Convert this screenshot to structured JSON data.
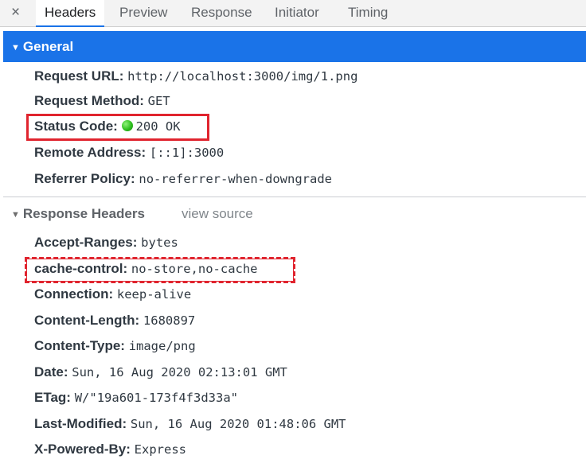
{
  "tabs": {
    "close_icon": "×",
    "items": [
      "Headers",
      "Preview",
      "Response",
      "Initiator",
      "Timing"
    ],
    "active": "Headers"
  },
  "general": {
    "title": "General",
    "rows": [
      {
        "key": "Request URL:",
        "value": "http://localhost:3000/img/1.png"
      },
      {
        "key": "Request Method:",
        "value": "GET"
      },
      {
        "key": "Status Code:",
        "value": "200 OK"
      },
      {
        "key": "Remote Address:",
        "value": "[::1]:3000"
      },
      {
        "key": "Referrer Policy:",
        "value": "no-referrer-when-downgrade"
      }
    ]
  },
  "response_headers": {
    "title": "Response Headers",
    "view_source": "view source",
    "rows": [
      {
        "key": "Accept-Ranges:",
        "value": "bytes"
      },
      {
        "key": "cache-control:",
        "value": "no-store,no-cache"
      },
      {
        "key": "Connection:",
        "value": "keep-alive"
      },
      {
        "key": "Content-Length:",
        "value": "1680897"
      },
      {
        "key": "Content-Type:",
        "value": "image/png"
      },
      {
        "key": "Date:",
        "value": "Sun, 16 Aug 2020 02:13:01 GMT"
      },
      {
        "key": "ETag:",
        "value": "W/\"19a601-173f4f3d33a\""
      },
      {
        "key": "Last-Modified:",
        "value": "Sun, 16 Aug 2020 01:48:06 GMT"
      },
      {
        "key": "X-Powered-By:",
        "value": "Express"
      }
    ]
  },
  "colors": {
    "accent": "#1a73e8",
    "highlight_box": "#e0242e",
    "status_ok": "#2fbf1f"
  },
  "icons": {
    "close": "close-icon",
    "expand": "triangle-down-icon",
    "status": "green-status-dot-icon"
  }
}
